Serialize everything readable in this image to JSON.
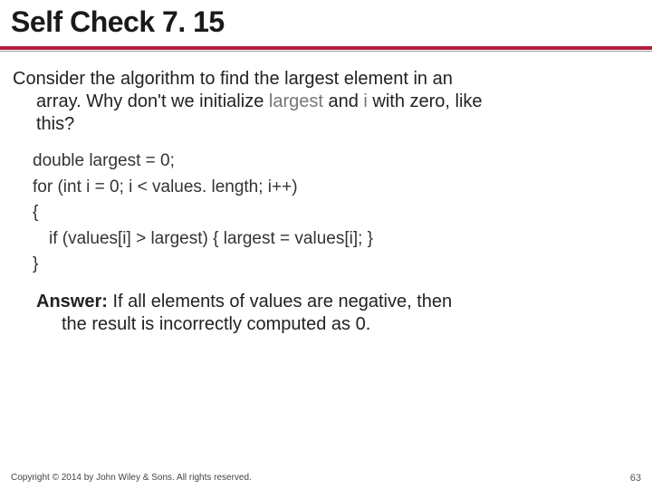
{
  "title": "Self Check 7. 15",
  "question": {
    "line1_prefix": "Consider the algorithm to find the largest element in an",
    "line2_a": "array. Why don't we initialize ",
    "ident_largest": "largest",
    "line2_b": " and ",
    "ident_i": "i",
    "line2_c": " with zero, like",
    "line3": "this?"
  },
  "code": {
    "l1": "double largest = 0;",
    "l2": "for (int i = 0; i < values. length; i++)",
    "l3": "{",
    "l4": "if (values[i] > largest) { largest = values[i]; }",
    "l5": "}"
  },
  "answer": {
    "label": "Answer:",
    "line1_rest": " If all elements of values are negative, then",
    "line2": "the result is incorrectly computed as 0."
  },
  "footer": {
    "copyright": "Copyright © 2014 by John Wiley & Sons. All rights reserved.",
    "page": "63"
  }
}
